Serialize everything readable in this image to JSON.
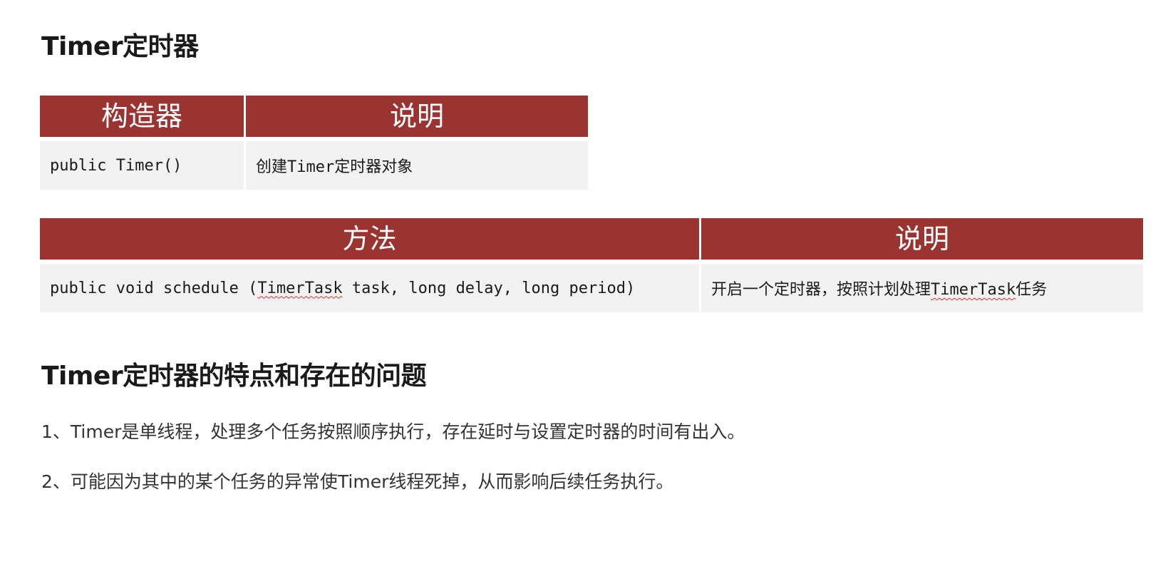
{
  "heading": {
    "title": "Timer定时器"
  },
  "constructor_table": {
    "headers": [
      "构造器",
      "说明"
    ],
    "rows": [
      {
        "signature": "public Timer()",
        "description": "创建Timer定时器对象"
      }
    ]
  },
  "method_table": {
    "headers": [
      "方法",
      "说明"
    ],
    "rows": [
      {
        "signature_prefix": "public void schedule (",
        "signature_type": "TimerTask",
        "signature_suffix": " task, long delay, long period)",
        "description_prefix": "开启一个定时器，按照计划处理",
        "description_type": "TimerTask",
        "description_suffix": "任务"
      }
    ]
  },
  "issues": {
    "title": "Timer定时器的特点和存在的问题",
    "items": [
      "1、Timer是单线程，处理多个任务按照顺序执行，存在延时与设置定时器的时间有出入。",
      "2、可能因为其中的某个任务的异常使Timer线程死掉，从而影响后续任务执行。"
    ]
  },
  "colors": {
    "header_bg": "#9b3330",
    "cell_bg": "#f2f2f2",
    "spellcheck_underline": "#d9302c"
  }
}
